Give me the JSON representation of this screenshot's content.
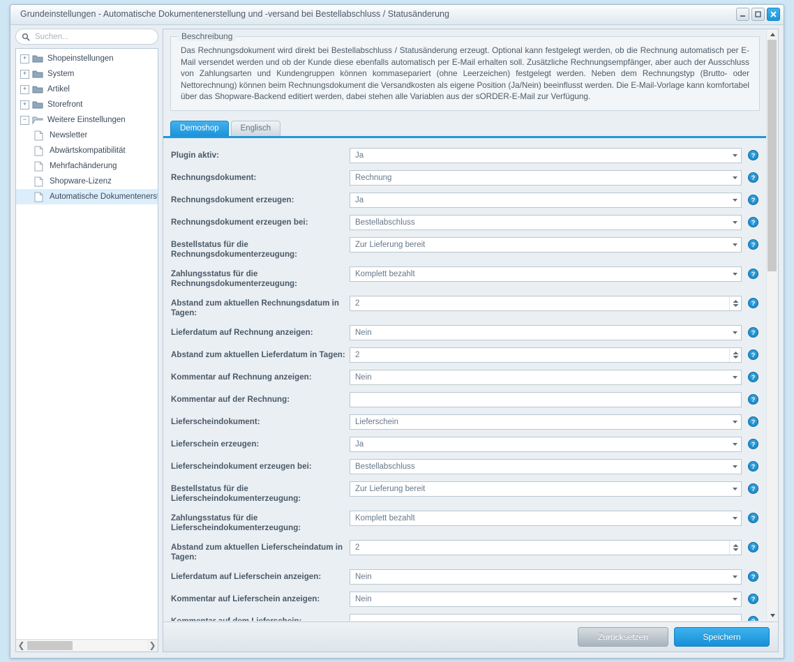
{
  "window": {
    "title": "Grundeinstellungen - Automatische Dokumentenerstellung und -versand bei Bestellabschluss / Statusänderung",
    "controls": {
      "minimize": "minimize",
      "maximize": "maximize",
      "close": "close"
    }
  },
  "sidebar": {
    "search": {
      "value": "",
      "placeholder": "Suchen..."
    },
    "tree": [
      {
        "label": "Shopeinstellungen",
        "type": "folder",
        "expander": "+",
        "depth": 0,
        "selected": false
      },
      {
        "label": "System",
        "type": "folder",
        "expander": "+",
        "depth": 0,
        "selected": false
      },
      {
        "label": "Artikel",
        "type": "folder",
        "expander": "+",
        "depth": 0,
        "selected": false
      },
      {
        "label": "Storefront",
        "type": "folder",
        "expander": "+",
        "depth": 0,
        "selected": false
      },
      {
        "label": "Weitere Einstellungen",
        "type": "folder-open",
        "expander": "−",
        "depth": 0,
        "selected": false
      },
      {
        "label": "Newsletter",
        "type": "file",
        "expander": "",
        "depth": 1,
        "selected": false
      },
      {
        "label": "Abwärtskompatibilität",
        "type": "file",
        "expander": "",
        "depth": 1,
        "selected": false
      },
      {
        "label": "Mehrfachänderung",
        "type": "file",
        "expander": "",
        "depth": 1,
        "selected": false
      },
      {
        "label": "Shopware-Lizenz",
        "type": "file",
        "expander": "",
        "depth": 1,
        "selected": false
      },
      {
        "label": "Automatische Dokumentenerst",
        "type": "file",
        "expander": "",
        "depth": 1,
        "selected": true
      }
    ]
  },
  "description": {
    "legend": "Beschreibung",
    "text": "Das Rechnungsdokument wird direkt bei Bestellabschluss / Statusänderung erzeugt. Optional kann festgelegt werden, ob die Rechnung automatisch per E-Mail versendet werden und ob der Kunde diese ebenfalls automatisch per E-Mail erhalten soll. Zusätzliche Rechnungsempfänger, aber auch der Ausschluss von Zahlungsarten und Kundengruppen können kommasepariert (ohne Leerzeichen) festgelegt werden. Neben dem Rechnungstyp (Brutto- oder Nettorechnung) können beim Rechnungsdokument die Versandkosten als eigene Position (Ja/Nein) beeinflusst werden. Die E-Mail-Vorlage kann komfortabel über das Shopware-Backend editiert werden, dabei stehen alle Variablen aus der sORDER-E-Mail zur Verfügung."
  },
  "tabs": [
    {
      "label": "Demoshop",
      "active": true
    },
    {
      "label": "Englisch",
      "active": false
    }
  ],
  "form": {
    "rows": [
      {
        "label": "Plugin aktiv:",
        "value": "Ja",
        "control": "select",
        "help": "?"
      },
      {
        "label": "Rechnungsdokument:",
        "value": "Rechnung",
        "control": "select",
        "help": "?"
      },
      {
        "label": "Rechnungsdokument erzeugen:",
        "value": "Ja",
        "control": "select",
        "help": "?"
      },
      {
        "label": "Rechnungsdokument erzeugen bei:",
        "value": "Bestellabschluss",
        "control": "select",
        "help": "?"
      },
      {
        "label": "Bestellstatus für die Rechnungsdokumenterzeugung:",
        "value": "Zur Lieferung bereit",
        "control": "select",
        "help": "?"
      },
      {
        "label": "Zahlungsstatus für die Rechnungsdokumenterzeugung:",
        "value": "Komplett bezahlt",
        "control": "select",
        "help": "?"
      },
      {
        "label": "Abstand zum aktuellen Rechnungsdatum in Tagen:",
        "value": "2",
        "control": "spinner",
        "help": "?"
      },
      {
        "label": "Lieferdatum auf Rechnung anzeigen:",
        "value": "Nein",
        "control": "select",
        "help": "?"
      },
      {
        "label": "Abstand zum aktuellen Lieferdatum in Tagen:",
        "value": "2",
        "control": "spinner",
        "help": "?"
      },
      {
        "label": "Kommentar auf Rechnung anzeigen:",
        "value": "Nein",
        "control": "select",
        "help": "?"
      },
      {
        "label": "Kommentar auf der Rechnung:",
        "value": "",
        "control": "text",
        "help": "?"
      },
      {
        "label": "Lieferscheindokument:",
        "value": "Lieferschein",
        "control": "select",
        "help": "?"
      },
      {
        "label": "Lieferschein erzeugen:",
        "value": "Ja",
        "control": "select",
        "help": "?"
      },
      {
        "label": "Lieferscheindokument erzeugen bei:",
        "value": "Bestellabschluss",
        "control": "select",
        "help": "?"
      },
      {
        "label": "Bestellstatus für die Lieferscheindokumenterzeugung:",
        "value": "Zur Lieferung bereit",
        "control": "select",
        "help": "?"
      },
      {
        "label": "Zahlungsstatus für die Lieferscheindokumenterzeugung:",
        "value": "Komplett bezahlt",
        "control": "select",
        "help": "?"
      },
      {
        "label": "Abstand zum aktuellen Lieferscheindatum in Tagen:",
        "value": "2",
        "control": "spinner",
        "help": "?"
      },
      {
        "label": "Lieferdatum auf Lieferschein anzeigen:",
        "value": "Nein",
        "control": "select",
        "help": "?"
      },
      {
        "label": "Kommentar auf Lieferschein anzeigen:",
        "value": "Nein",
        "control": "select",
        "help": "?"
      },
      {
        "label": "Kommentar auf dem Lieferschein:",
        "value": "",
        "control": "text",
        "help": "?"
      }
    ]
  },
  "footer": {
    "reset_label": "Zurücksetzen",
    "save_label": "Speichern"
  },
  "scrollbars": {
    "vertical_up": "▲",
    "vertical_down": "▼",
    "horizontal_left": "❮",
    "horizontal_right": "❯"
  },
  "colors": {
    "accent": "#1f97dc",
    "selection": "#dceefb",
    "window_bg": "#e8eef3",
    "desktop": "#cfe6f5"
  }
}
